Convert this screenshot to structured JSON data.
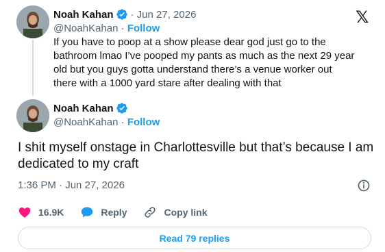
{
  "quoted_tweet": {
    "author_name": "Noah Kahan",
    "date": "· Jun 27, 2026",
    "handle": "@NoahKahan",
    "separator": "·",
    "follow_label": "Follow",
    "text": "If you have to poop at a show please dear god just go to the bathroom lmao I’ve pooped my pants as much as the next 29 year old but you guys gotta understand there’s a venue worker out there with a 1000 yard stare after dealing with that"
  },
  "main_tweet": {
    "author_name": "Noah Kahan",
    "handle": "@NoahKahan",
    "separator": "·",
    "follow_label": "Follow",
    "text": "I shit myself onstage in Charlottesville but that’s because I am dedicated to my craft",
    "timestamp": "1:36 PM · Jun 27, 2026"
  },
  "actions": {
    "like_count": "16.9K",
    "reply_label": "Reply",
    "copy_link_label": "Copy link"
  },
  "read_replies_label": "Read 79 replies",
  "brand_logo": "𝕏",
  "icons": {
    "verified": "verified-badge-icon",
    "like": "heart-icon",
    "reply": "speech-bubble-icon",
    "copy": "link-icon",
    "info": "info-icon"
  },
  "colors": {
    "accent": "#1d9bf0",
    "like": "#f91880",
    "muted": "#536471",
    "border": "#cfd9de",
    "text": "#0f1419"
  }
}
